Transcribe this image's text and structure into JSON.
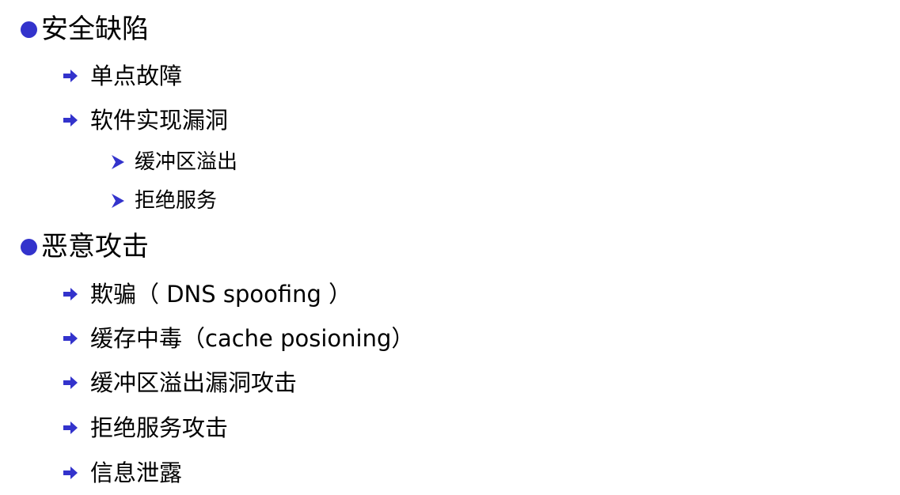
{
  "colors": {
    "bullet": "#3333cc",
    "text": "#000000"
  },
  "icons": {
    "level1": "filled-circle-bullet-icon",
    "level2": "right-arrow-bullet-icon",
    "level3": "chevron-right-bullet-icon"
  },
  "sections": [
    {
      "heading": "安全缺陷",
      "items": [
        {
          "text": "单点故障"
        },
        {
          "text": "软件实现漏洞",
          "subitems": [
            "缓冲区溢出",
            "拒绝服务"
          ]
        }
      ]
    },
    {
      "heading": "恶意攻击",
      "items": [
        {
          "text": "欺骗（ DNS spoofing ）"
        },
        {
          "text": "缓存中毒（cache posioning）"
        },
        {
          "text": "缓冲区溢出漏洞攻击"
        },
        {
          "text": "拒绝服务攻击"
        },
        {
          "text": "信息泄露"
        }
      ]
    }
  ]
}
